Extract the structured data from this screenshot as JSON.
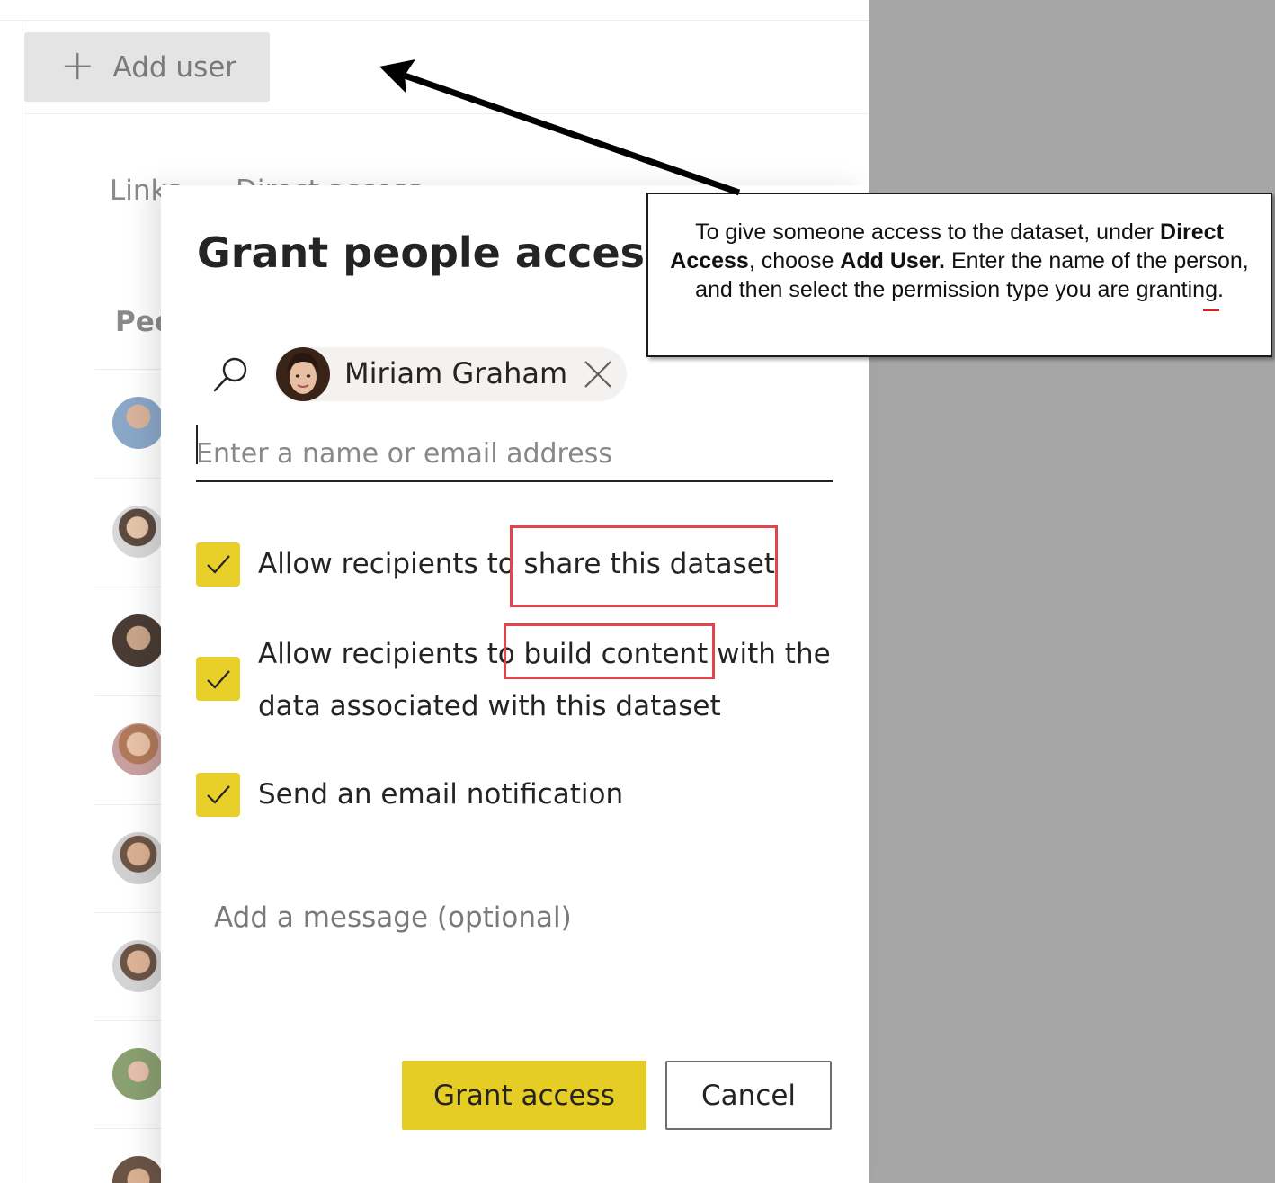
{
  "page": {
    "add_user_label": "Add user",
    "tabs": [
      {
        "label": "Links"
      },
      {
        "label": "Direct access"
      }
    ],
    "people_heading": "People"
  },
  "dialog": {
    "title": "Grant people access",
    "recipient": {
      "name": "Miriam Graham"
    },
    "name_input": {
      "placeholder": "Enter a name or email address",
      "value": ""
    },
    "options": [
      {
        "label": "Allow recipients to share this dataset",
        "checked": true
      },
      {
        "label_line1": "Allow recipients to build content with the",
        "label_line2": "data associated with this dataset",
        "checked": true
      },
      {
        "label": "Send an email notification",
        "checked": true
      }
    ],
    "message": {
      "placeholder": "Add a message (optional)"
    },
    "primary_button": "Grant access",
    "secondary_button": "Cancel"
  },
  "callout": {
    "t1": "To give someone access to the dataset, under ",
    "b1": "Direct Access",
    "t2": ", choose ",
    "b2": "Add User.",
    "t3": " Enter the name of the person, and then select the permission type you are granting."
  },
  "colors": {
    "accent": "#e5cd26",
    "highlight": "#e0464b",
    "backdrop": "#a6a6a6"
  }
}
